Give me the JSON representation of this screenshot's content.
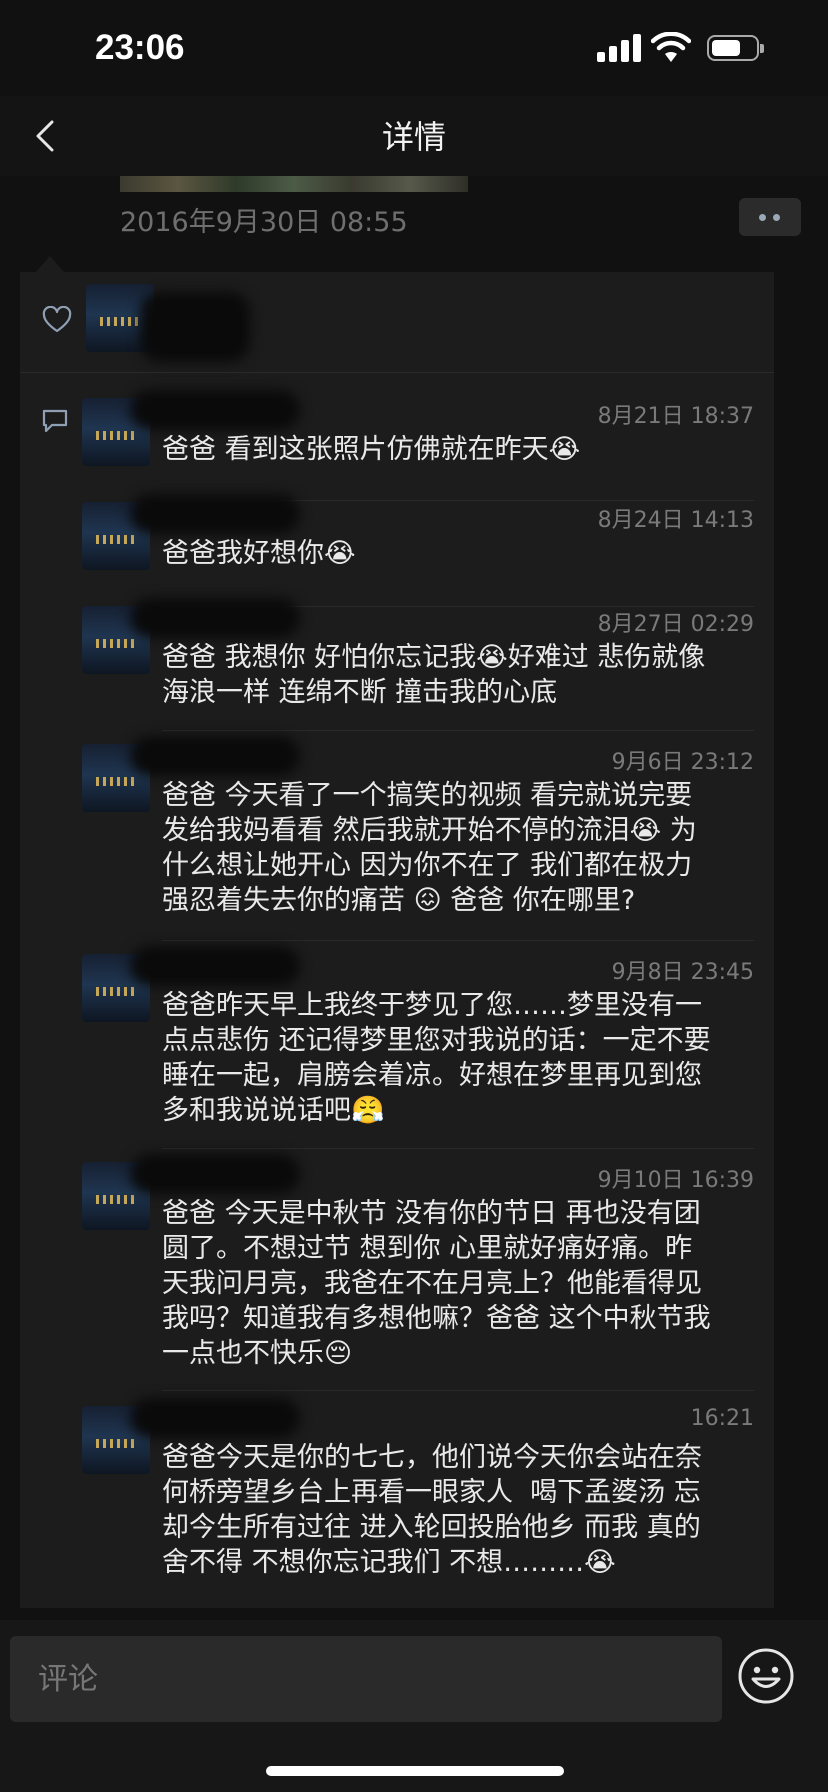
{
  "status_bar": {
    "time": "23:06"
  },
  "nav": {
    "title": "详情"
  },
  "post": {
    "timestamp": "2016年9月30日 08:55"
  },
  "icons": {
    "back": "chevron-left-icon",
    "more": "more-dots-icon",
    "like": "heart-icon",
    "comment": "comment-icon",
    "emoji": "smiley-icon"
  },
  "comments": [
    {
      "time": "8月21日 18:37",
      "text": "爸爸 看到这张照片仿佛就在昨天😭"
    },
    {
      "time": "8月24日 14:13",
      "text": "爸爸我好想你😭"
    },
    {
      "time": "8月27日 02:29",
      "text": "爸爸 我想你 好怕你忘记我😭好难过 悲伤就像\n海浪一样 连绵不断 撞击我的心底"
    },
    {
      "time": "9月6日 23:12",
      "text": "爸爸 今天看了一个搞笑的视频 看完就说完要\n发给我妈看看 然后我就开始不停的流泪😭 为\n什么想让她开心 因为你不在了 我们都在极力\n强忍着失去你的痛苦 😖 爸爸 你在哪里?"
    },
    {
      "time": "9月8日 23:45",
      "text": "爸爸昨天早上我终于梦见了您……梦里没有一\n点点悲伤 还记得梦里您对我说的话：一定不要\n睡在一起，肩膀会着凉。好想在梦里再见到您\n多和我说说话吧😤"
    },
    {
      "time": "9月10日 16:39",
      "text": "爸爸 今天是中秋节 没有你的节日 再也没有团\n圆了。不想过节 想到你 心里就好痛好痛。昨\n天我问月亮，我爸在不在月亮上？他能看得见\n我吗？知道我有多想他嘛？爸爸 这个中秋节我\n一点也不快乐😔"
    },
    {
      "time": "16:21",
      "text": "爸爸今天是你的七七，他们说今天你会站在奈\n何桥旁望乡台上再看一眼家人  喝下孟婆汤 忘\n却今生所有过往 进入轮回投胎他乡 而我 真的\n舍不得 不想你忘记我们 不想………😭"
    }
  ],
  "input": {
    "placeholder": "评论"
  }
}
